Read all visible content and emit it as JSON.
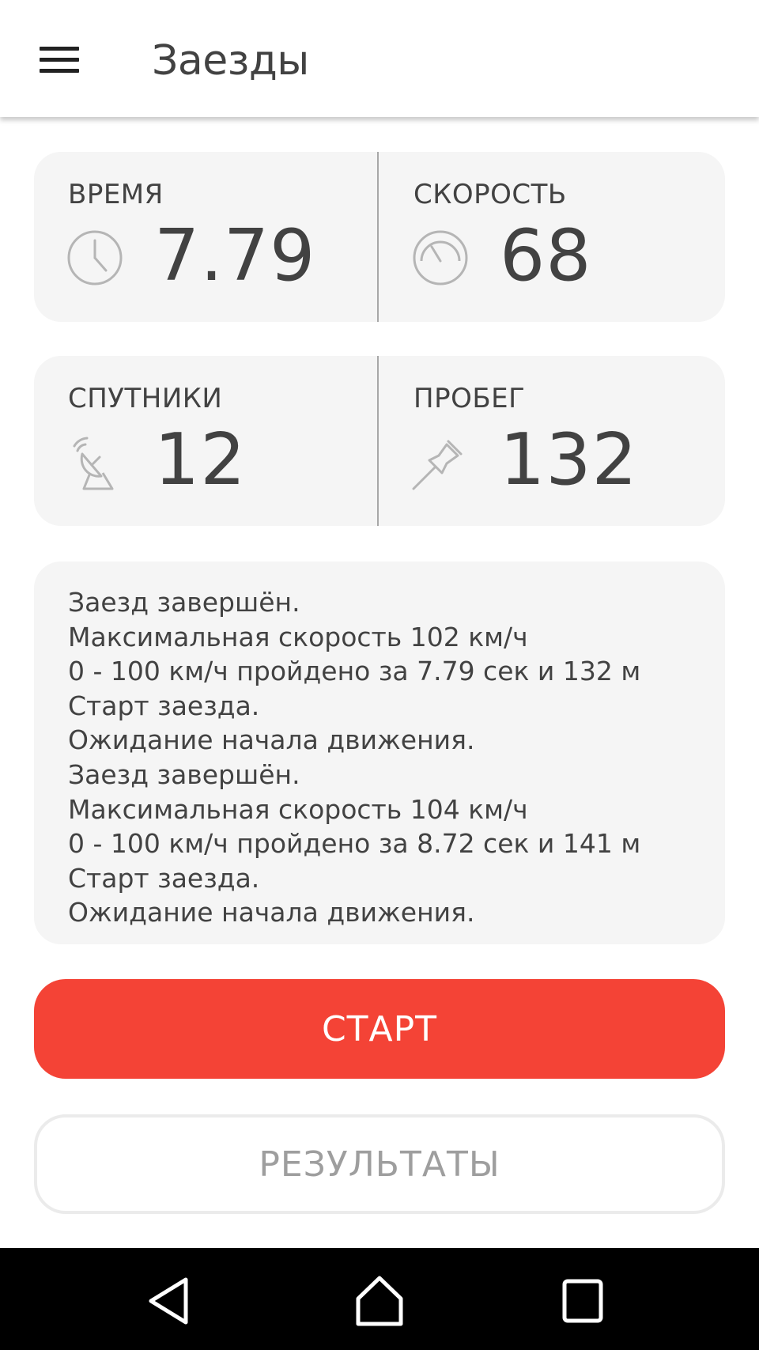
{
  "header": {
    "title": "Заезды",
    "menu_icon": "hamburger-menu-icon"
  },
  "stats": [
    {
      "label": "ВРЕМЯ",
      "value": "7.79",
      "icon": "clock-icon"
    },
    {
      "label": "СКОРОСТЬ",
      "value": "68",
      "icon": "speedometer-icon"
    },
    {
      "label": "СПУТНИКИ",
      "value": "12",
      "icon": "satellite-dish-icon"
    },
    {
      "label": "ПРОБЕГ",
      "value": "132",
      "icon": "pushpin-icon"
    }
  ],
  "log": [
    "Заезд завершён.",
    "Максимальная скорость 102 км/ч",
    "0 - 100 км/ч пройдено за 7.79 сек и 132 м",
    "Старт заезда.",
    "Ожидание начала движения.",
    "Заезд завершён.",
    "Максимальная скорость 104 км/ч",
    "0 - 100 км/ч пройдено за 8.72 сек и 141 м",
    "Старт заезда.",
    "Ожидание начала движения."
  ],
  "buttons": {
    "start_label": "СТАРТ",
    "results_label": "РЕЗУЛЬТАТЫ"
  },
  "colors": {
    "accent": "#f44336",
    "card_background": "#f5f5f5",
    "text": "#424242"
  },
  "system_nav": {
    "back_icon": "back-triangle-icon",
    "home_icon": "home-icon",
    "recents_icon": "recents-square-icon"
  }
}
